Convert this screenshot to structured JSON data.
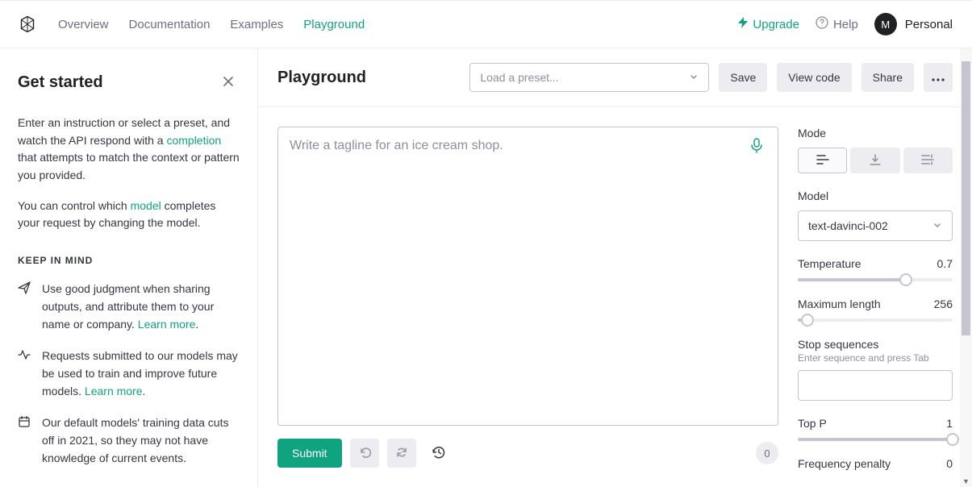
{
  "header": {
    "nav": {
      "overview": "Overview",
      "documentation": "Documentation",
      "examples": "Examples",
      "playground": "Playground"
    },
    "upgrade": "Upgrade",
    "help": "Help",
    "avatar_initial": "M",
    "account_label": "Personal"
  },
  "sidebar": {
    "title": "Get started",
    "intro_1": "Enter an instruction or select a preset, and watch the API respond with a ",
    "intro_link_1": "completion",
    "intro_2": " that attempts to match the context or pattern you provided.",
    "para2_1": "You can control which ",
    "para2_link": "model",
    "para2_2": " completes your request by changing the model.",
    "keep_in_mind": "KEEP IN MIND",
    "tips": [
      {
        "text": "Use good judgment when sharing outputs, and attribute them to your name or company. ",
        "link": "Learn more"
      },
      {
        "text": "Requests submitted to our models may be used to train and improve future models. ",
        "link": "Learn more"
      },
      {
        "text": "Our default models' training data cuts off in 2021, so they may not have knowledge of current events.",
        "link": ""
      }
    ]
  },
  "toolbar": {
    "title": "Playground",
    "preset_placeholder": "Load a preset...",
    "save": "Save",
    "view_code": "View code",
    "share": "Share"
  },
  "editor": {
    "placeholder": "Write a tagline for an ice cream shop.",
    "submit": "Submit",
    "token_count": "0"
  },
  "settings": {
    "mode_label": "Mode",
    "model_label": "Model",
    "model_value": "text-davinci-002",
    "temperature_label": "Temperature",
    "temperature_value": "0.7",
    "temperature_pct": 70,
    "max_len_label": "Maximum length",
    "max_len_value": "256",
    "max_len_pct": 6,
    "stop_label": "Stop sequences",
    "stop_hint": "Enter sequence and press Tab",
    "top_p_label": "Top P",
    "top_p_value": "1",
    "top_p_pct": 100,
    "freq_label": "Frequency penalty",
    "freq_value": "0"
  }
}
